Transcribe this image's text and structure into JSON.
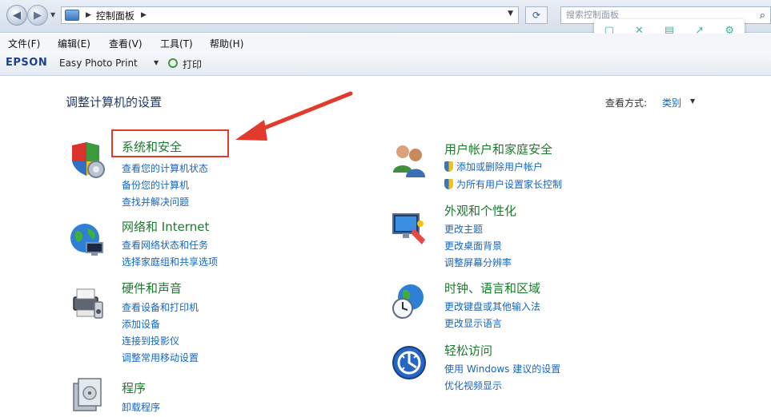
{
  "address": {
    "breadcrumb": "控制面板",
    "search_placeholder": "搜索控制面板"
  },
  "menu": {
    "file": "文件(F)",
    "edit": "编辑(E)",
    "view": "查看(V)",
    "tools": "工具(T)",
    "help": "帮助(H)"
  },
  "epson": {
    "logo": "EPSON",
    "app": "Easy Photo Print",
    "print": "打印"
  },
  "content": {
    "title": "调整计算机的设置",
    "view_by_label": "查看方式:",
    "view_by_value": "类别"
  },
  "categories": {
    "system_security": {
      "title": "系统和安全",
      "links": [
        "查看您的计算机状态",
        "备份您的计算机",
        "查找并解决问题"
      ]
    },
    "network": {
      "title": "网络和 Internet",
      "links": [
        "查看网络状态和任务",
        "选择家庭组和共享选项"
      ]
    },
    "hardware": {
      "title": "硬件和声音",
      "links": [
        "查看设备和打印机",
        "添加设备",
        "连接到投影仪",
        "调整常用移动设置"
      ]
    },
    "programs": {
      "title": "程序",
      "links": [
        "卸载程序"
      ]
    },
    "user_accounts": {
      "title": "用户帐户和家庭安全",
      "links": [
        "添加或删除用户帐户",
        "为所有用户设置家长控制"
      ]
    },
    "appearance": {
      "title": "外观和个性化",
      "links": [
        "更改主题",
        "更改桌面背景",
        "调整屏幕分辨率"
      ]
    },
    "clock": {
      "title": "时钟、语言和区域",
      "links": [
        "更改键盘或其他输入法",
        "更改显示语言"
      ]
    },
    "ease": {
      "title": "轻松访问",
      "links": [
        "使用 Windows 建议的设置",
        "优化视频显示"
      ]
    }
  },
  "colors": {
    "category_title": "#1b7a2c",
    "link": "#1565c0",
    "annotation": "#e23b2e"
  }
}
